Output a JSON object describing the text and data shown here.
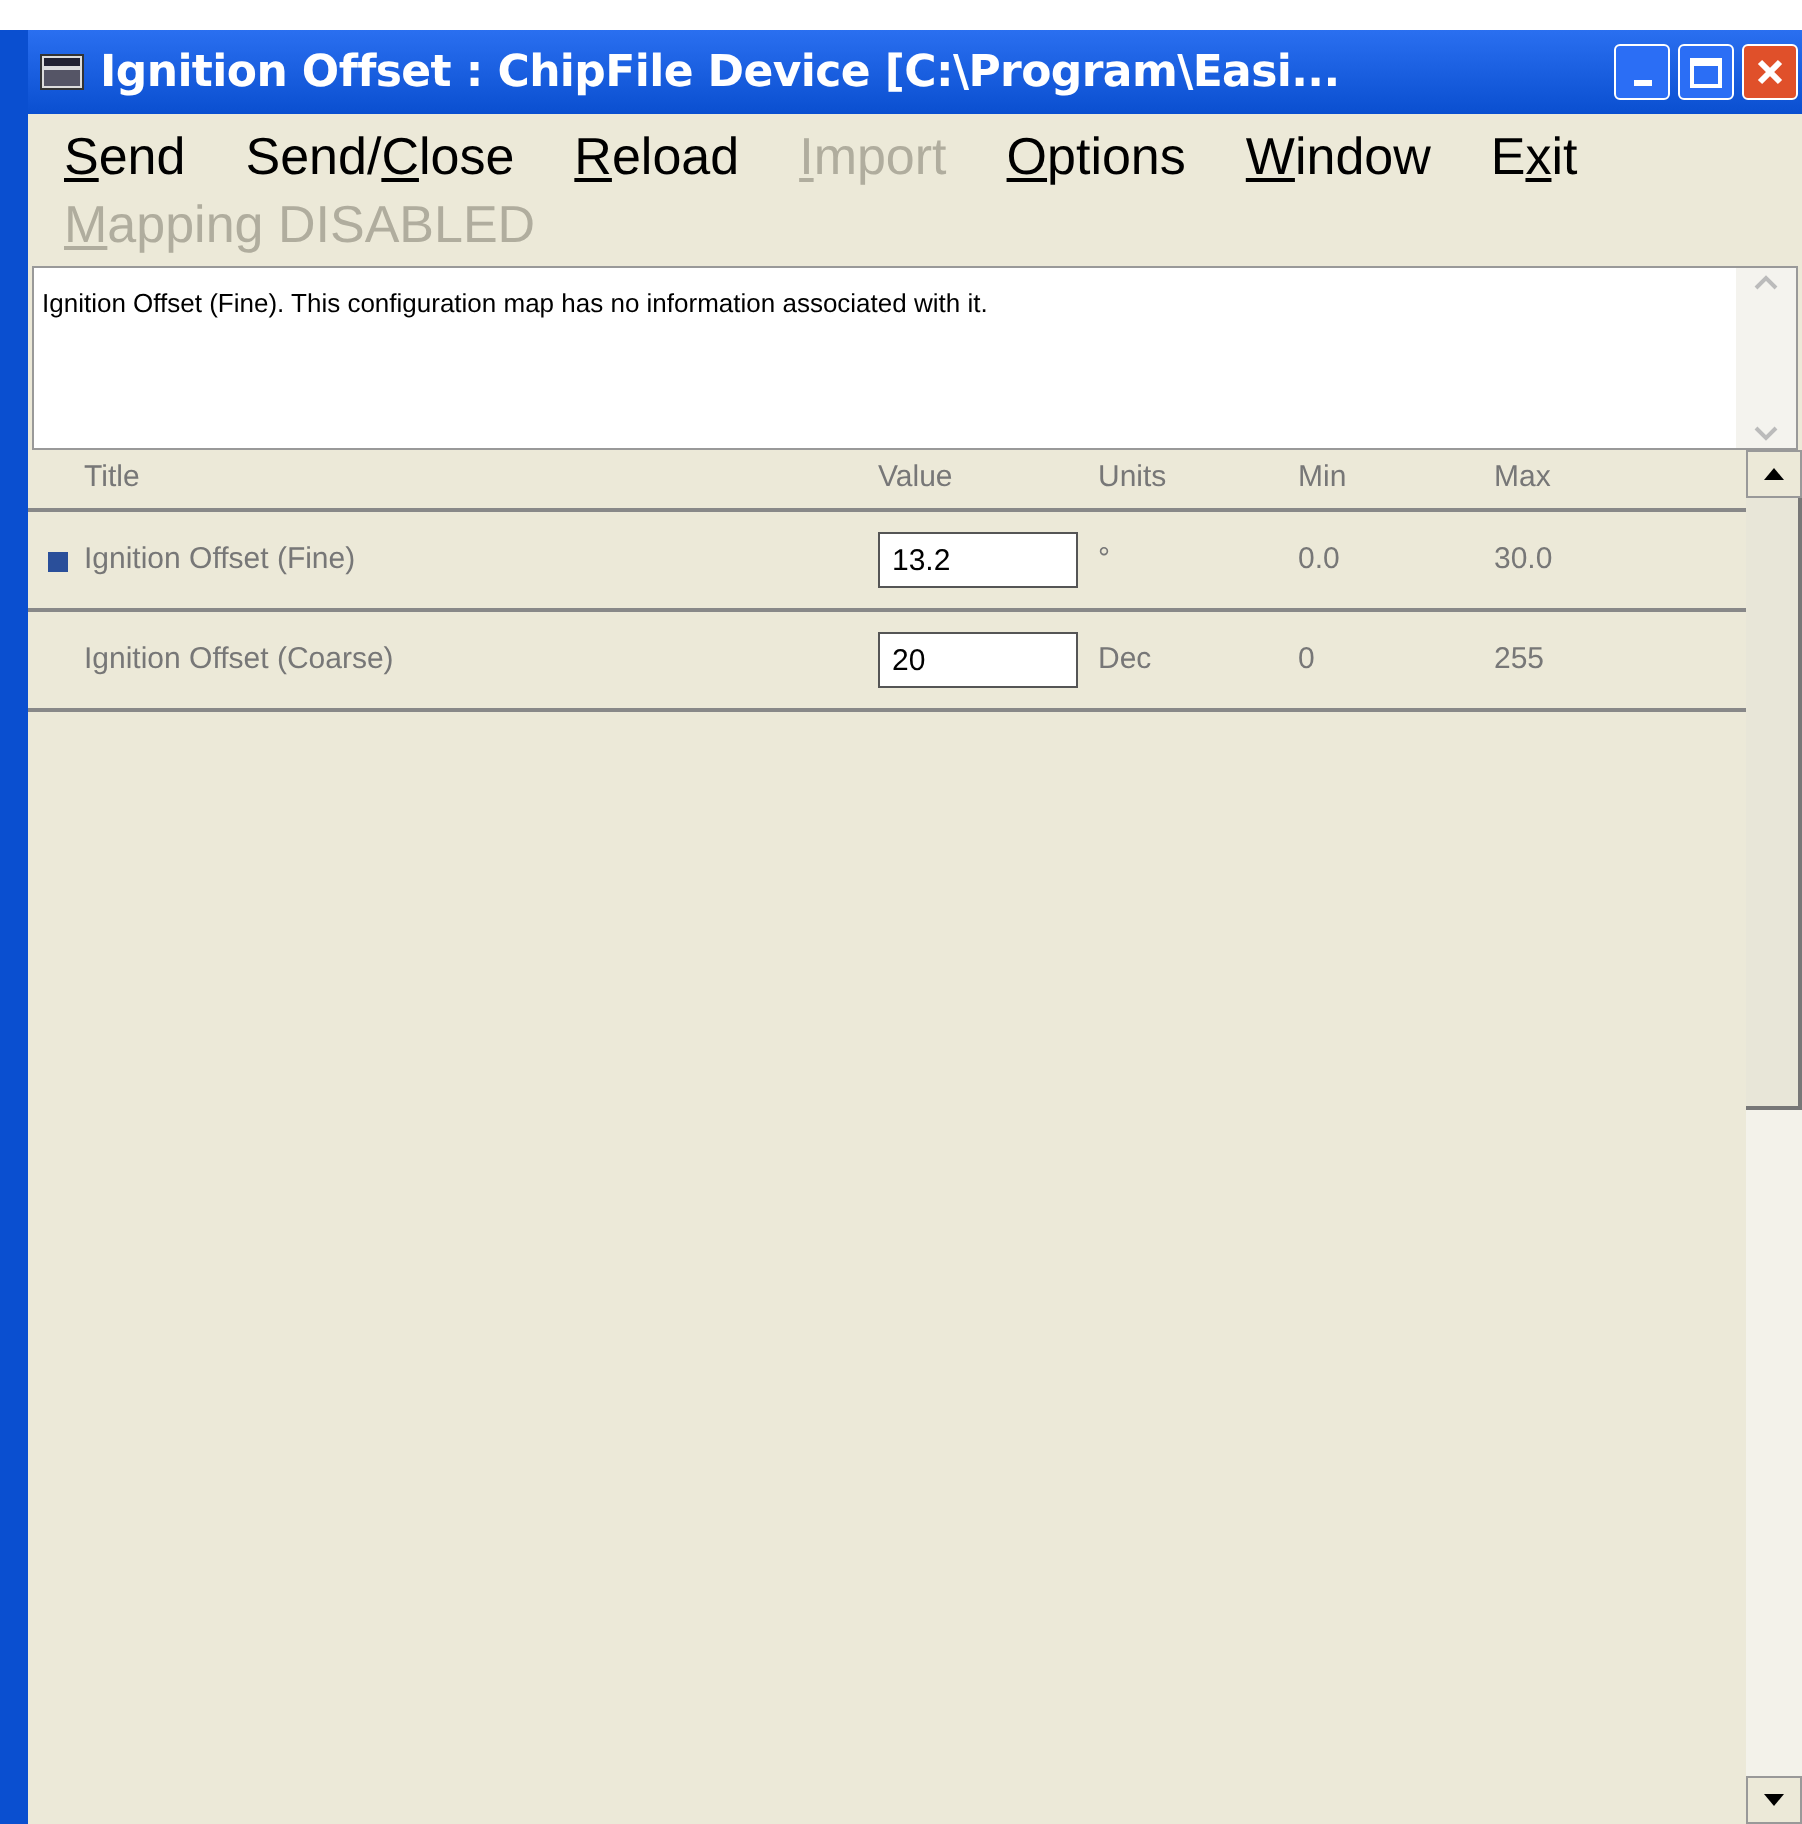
{
  "window": {
    "title": "Ignition Offset : ChipFile Device [C:\\Program\\Easi..."
  },
  "menu": [
    {
      "key": "S",
      "after": "end",
      "disabled": false
    },
    {
      "before": "Send/",
      "key": "C",
      "after": "lose",
      "disabled": false
    },
    {
      "key": "R",
      "after": "eload",
      "disabled": false
    },
    {
      "key": "I",
      "after": "mport",
      "disabled": true
    },
    {
      "key": "O",
      "after": "ptions",
      "disabled": false
    },
    {
      "key": "W",
      "after": "indow",
      "disabled": false
    },
    {
      "before": "E",
      "key": "x",
      "after": "it",
      "disabled": false
    },
    {
      "key": "M",
      "after": "apping DISABLED",
      "disabled": true
    }
  ],
  "info": "Ignition Offset (Fine). This configuration map has no information associated with it.",
  "table": {
    "columns": [
      "Title",
      "Value",
      "Units",
      "Min",
      "Max"
    ],
    "rows": [
      {
        "title": "Ignition Offset (Fine)",
        "value": "13.2",
        "units": "°",
        "min": "0.0",
        "max": "30.0",
        "selected": true
      },
      {
        "title": "Ignition Offset (Coarse)",
        "value": "20",
        "units": "Dec",
        "min": "0",
        "max": "255",
        "selected": false
      }
    ]
  }
}
